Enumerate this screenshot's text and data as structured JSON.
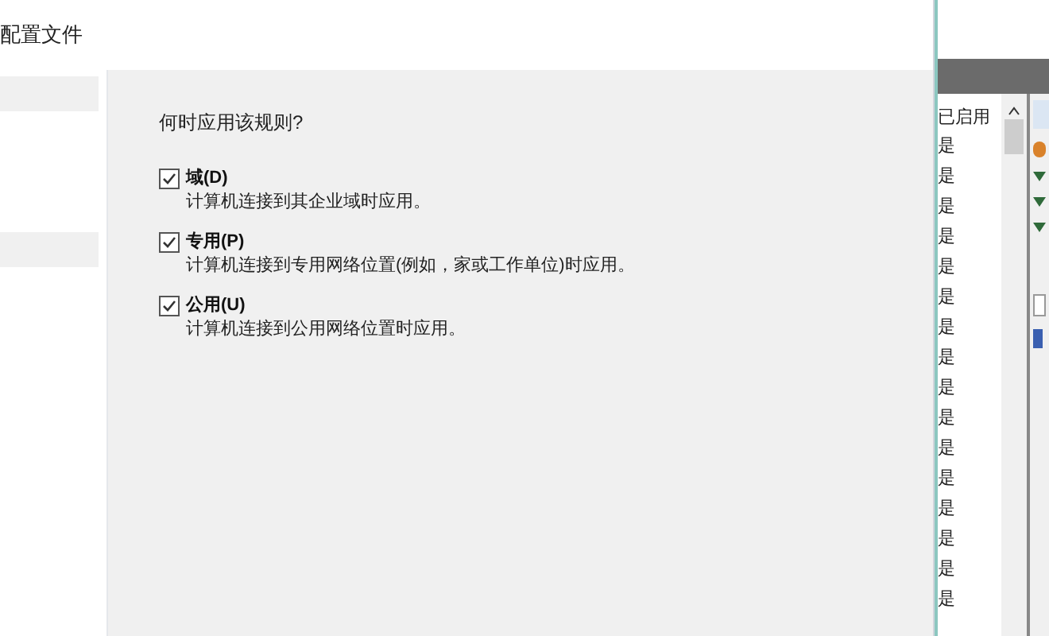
{
  "dialog": {
    "title": "配置文件",
    "question": "何时应用该规则?",
    "options": [
      {
        "label": "域(D)",
        "description": "计算机连接到其企业域时应用。",
        "checked": true
      },
      {
        "label": "专用(P)",
        "description": "计算机连接到专用网络位置(例如，家或工作单位)时应用。",
        "checked": true
      },
      {
        "label": "公用(U)",
        "description": "计算机连接到公用网络位置时应用。",
        "checked": true
      }
    ]
  },
  "background_list": {
    "column": "已启用",
    "rows": [
      "是",
      "是",
      "是",
      "是",
      "是",
      "是",
      "是",
      "是",
      "是",
      "是",
      "是",
      "是",
      "是",
      "是",
      "是",
      "是"
    ]
  }
}
